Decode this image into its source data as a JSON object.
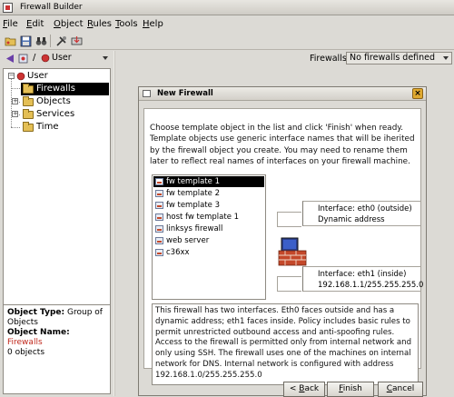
{
  "window": {
    "title": "Firewall Builder"
  },
  "menu": {
    "items": [
      {
        "label": "File",
        "underline": "F",
        "rest": "ile"
      },
      {
        "label": "Edit",
        "underline": "E",
        "rest": "dit"
      },
      {
        "label": "Object",
        "underline": "O",
        "rest": "bject"
      },
      {
        "label": "Rules",
        "underline": "R",
        "rest": "ules"
      },
      {
        "label": "Tools",
        "underline": "T",
        "rest": "ools"
      },
      {
        "label": "Help",
        "underline": "H",
        "rest": "elp"
      }
    ]
  },
  "toolbar": {
    "buttons": [
      "open-folder-icon",
      "save-icon",
      "binoculars-icon",
      "compile-icon",
      "install-icon"
    ]
  },
  "left_pane": {
    "library_selector": "User",
    "tree": [
      {
        "label": "User",
        "level": 0,
        "selected": false
      },
      {
        "label": "Firewalls",
        "level": 1,
        "selected": true
      },
      {
        "label": "Objects",
        "level": 1,
        "selected": false
      },
      {
        "label": "Services",
        "level": 1,
        "selected": false
      },
      {
        "label": "Time",
        "level": 1,
        "selected": false
      }
    ],
    "info": {
      "type_label": "Object Type:",
      "type_value": "Group of Objects",
      "name_label": "Object Name:",
      "name_value": "Firewalls",
      "count": "0 objects"
    }
  },
  "right_pane": {
    "firewalls_label": "Firewalls:",
    "firewalls_value": "No firewalls defined"
  },
  "dialog": {
    "title": "New Firewall",
    "close_glyph": "×",
    "instructions": "Choose template object in the list and click 'Finish' when ready. Template objects use generic interface names that will be iherited by the firewall object you create. You may need to rename them later to reflect real names of interfaces on your firewall machine.",
    "templates": [
      {
        "label": "fw template 1",
        "selected": true
      },
      {
        "label": "fw template 2",
        "selected": false
      },
      {
        "label": "fw template 3",
        "selected": false
      },
      {
        "label": "host fw template 1",
        "selected": false
      },
      {
        "label": "linksys firewall",
        "selected": false
      },
      {
        "label": "web server",
        "selected": false
      },
      {
        "label": "c36xx",
        "selected": false
      }
    ],
    "interface_outside": {
      "line1": "Interface: eth0 (outside)",
      "line2": "Dynamic address"
    },
    "interface_inside": {
      "line1": "Interface: eth1 (inside)",
      "line2": "192.168.1.1/255.255.255.0"
    },
    "description": "This firewall has two interfaces. Eth0 faces outside and has a dynamic address; eth1 faces inside. Policy includes basic rules to permit unrestricted outbound access and anti-spoofing rules. Access to the firewall is permitted only from internal network and only using SSH. The firewall uses one of the machines on internal network for DNS. Internal network is configured with address 192.168.1.0/255.255.255.0",
    "buttons": {
      "back": {
        "prefix": "< ",
        "underline": "B",
        "rest": "ack"
      },
      "finish": {
        "underline": "F",
        "rest": "inish"
      },
      "cancel": {
        "underline": "C",
        "rest": "ancel"
      }
    }
  },
  "colors": {
    "window_bg": "#dcdad5",
    "selection_bg": "#000000",
    "red_value": "#c0281c",
    "library_arrow": "#6a3fa8"
  }
}
